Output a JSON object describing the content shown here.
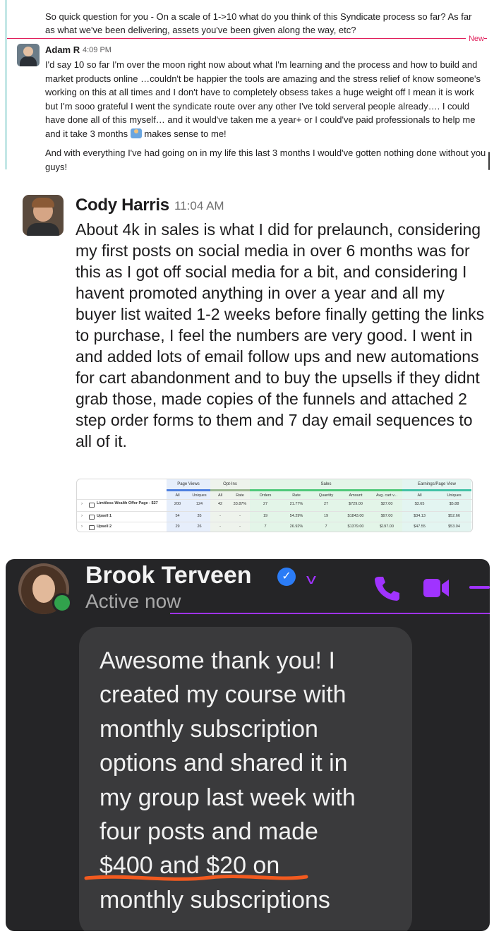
{
  "slack": {
    "question": "So quick question for you - On a scale of 1->10 what do you think of this Syndicate process so far? As far as what we've been delivering, assets you've been given along the way, etc?",
    "new_label": "New",
    "author": "Adam R",
    "time": "4:09 PM",
    "paragraph_1a": "I'd say 10 so far I'm over the moon right now about what I'm learning and the process and how to build and market products online …couldn't be happier the tools are amazing and the stress relief of know someone's working on this at all times and I don't have to completely obsess takes a huge weight off I mean it is work but I'm sooo grateful I went the syndicate route over any other I've told serveral people already…. I could have done all of this myself… and it would've taken me a year+ or I could've paid professionals to help me and it take 3 months",
    "paragraph_1b": "makes sense to me!",
    "paragraph_2": "And with everything I've had going on in my life this last 3 months I would've gotten nothing done without you guys!",
    "emoji": "person-at-laptop-emoji"
  },
  "cody": {
    "author": "Cody Harris",
    "time": "11:04 AM",
    "message": "About 4k in sales is what I did for prelaunch, considering my first posts on social media in over 6 months was for this as I got off social media for a bit, and considering I havent promoted anything in over a year and all my buyer list waited 1-2 weeks before finally getting the links to purchase, I feel the numbers are very good. I went in and added lots of email follow ups and new automations for cart abandonment and to buy the upsells if they didnt grab those, made copies of the funnels and attached 2 step order forms to them and 7 day email sequences to all of it.",
    "table": {
      "groups": {
        "views": "Page Views",
        "optins": "Opt-Ins",
        "sales": "Sales",
        "earnings": "Earnings/Page View"
      },
      "subheaders": [
        "All",
        "Uniques",
        "All",
        "Rate",
        "Orders",
        "Rate",
        "Quantity",
        "Amount",
        "Avg. cart v...",
        "All",
        "Uniques"
      ],
      "rows": [
        {
          "label": "Limitless Wealth Offer Page - $27",
          "cells": [
            "200",
            "124",
            "42",
            "33.87%",
            "27",
            "21.77%",
            "27",
            "$729.00",
            "$27.00",
            "$3.65",
            "$5.88"
          ]
        },
        {
          "label": "Upsell 1",
          "cells": [
            "54",
            "35",
            "-",
            "-",
            "19",
            "54.29%",
            "19",
            "$1843.00",
            "$97.00",
            "$34.13",
            "$52.66"
          ]
        },
        {
          "label": "Upsell 2",
          "cells": [
            "29",
            "26",
            "-",
            "-",
            "7",
            "26.92%",
            "7",
            "$1379.00",
            "$197.00",
            "$47.55",
            "$53.04"
          ]
        }
      ]
    }
  },
  "messenger": {
    "name": "Brook Terveen",
    "status": "Active now",
    "message_lines": [
      "Awesome thank you! I",
      "created my course with",
      "monthly subscription",
      "options and shared it in",
      "my group last week with",
      "four posts and made",
      "$400 and $20 on",
      "monthly subscriptions"
    ],
    "accent": "#a033ff",
    "highlight": "#f25a1f",
    "online": "#31a24c"
  }
}
